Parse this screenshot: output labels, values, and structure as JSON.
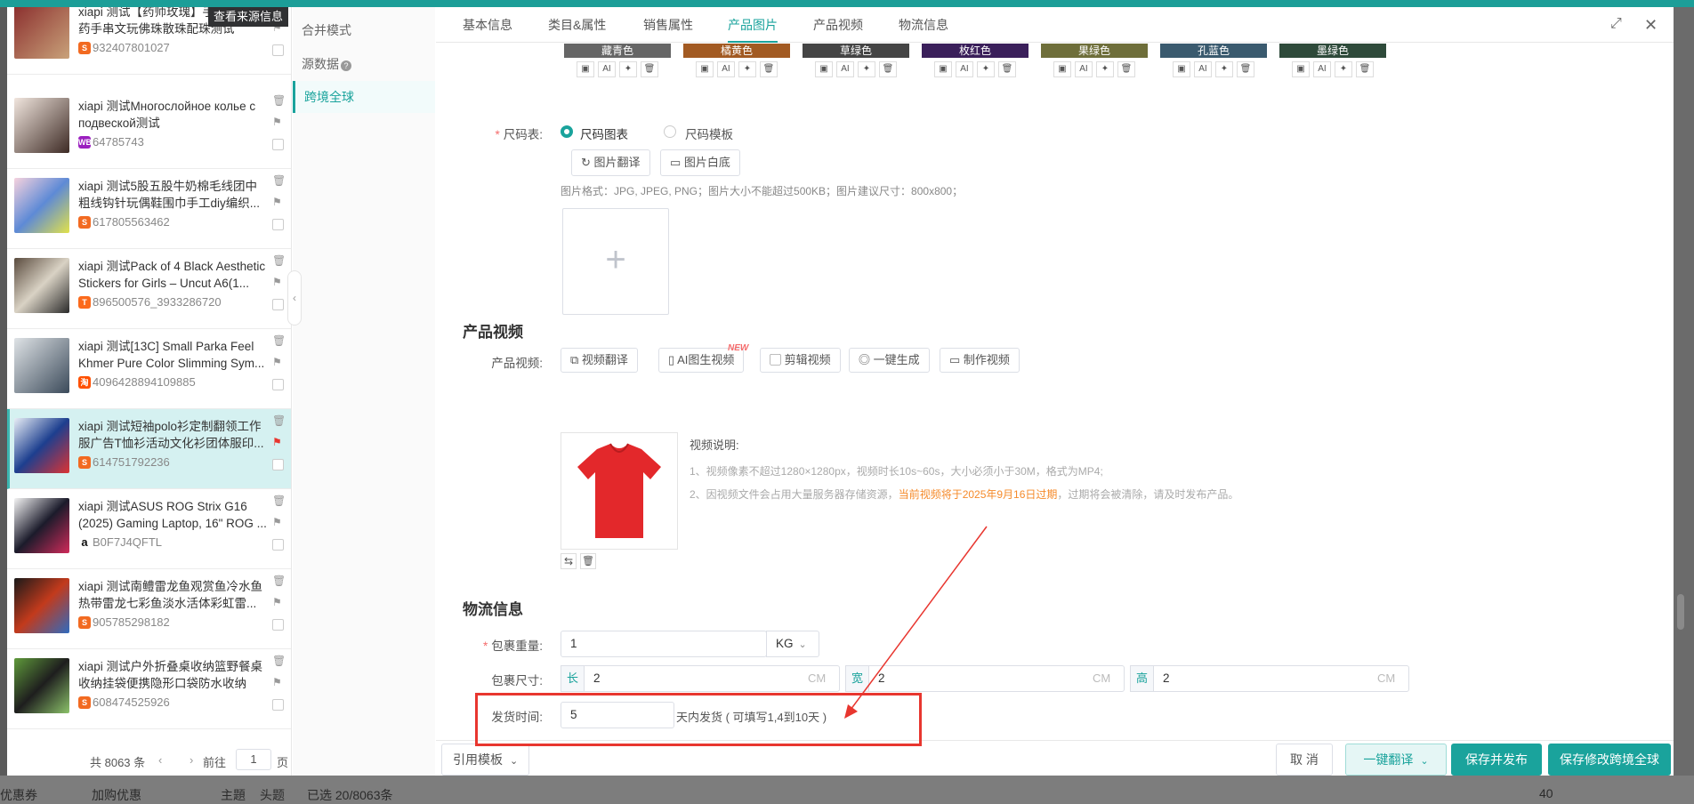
{
  "colors": {
    "accent": "#1aa39c",
    "danger": "#e8362f",
    "warning": "#f58a2a"
  },
  "list": {
    "tooltip": "查看来源信息",
    "items": [
      {
        "title": "xiapi 测试【药师玫瑰】手串厂家中药手串文玩佛珠散珠配珠测试",
        "id": "932407801027",
        "badge": "shopee",
        "badge_color": "#f26a21"
      },
      {
        "title": "xiapi 测试Многослойное колье с подвеской测试",
        "id": "64785743",
        "badge": "WB",
        "badge_color": "#9b1fbf"
      },
      {
        "title": "xiapi 测试5股五股牛奶棉毛线团中粗线钩针玩偶鞋围巾手工diy编织...",
        "id": "617805563462",
        "badge": "shopee",
        "badge_color": "#f26a21"
      },
      {
        "title": "xiapi 测试Pack of 4 Black Aesthetic Stickers for Girls – Uncut A6(1...",
        "id": "896500576_3933286720",
        "badge": "temu",
        "badge_color": "#fb6a1c"
      },
      {
        "title": "xiapi 测试[13C] Small Parka Feel Khmer Pure Color Slimming Sym...",
        "id": "4096428894109885",
        "badge": "taobao",
        "badge_color": "#ff5000"
      },
      {
        "title": "xiapi 测试短袖polo衫定制翻领工作服广告T恤衫活动文化衫团体服印...",
        "id": "614751792236",
        "badge": "shopee",
        "badge_color": "#f26a21"
      },
      {
        "title": "xiapi 测试ASUS ROG Strix G16 (2025) Gaming Laptop, 16\" ROG ...",
        "id": "B0F7J4QFTL",
        "badge": "amazon",
        "badge_color": "#ffffff"
      },
      {
        "title": "xiapi 测试南鳢雷龙鱼观赏鱼冷水鱼热带雷龙七彩鱼淡水活体彩虹雷...",
        "id": "905785298182",
        "badge": "shopee",
        "badge_color": "#f26a21"
      },
      {
        "title": "xiapi 测试户外折叠桌收纳篮野餐桌收纳挂袋便携隐形口袋防水收纳袋...",
        "id": "608474525926",
        "badge": "shopee",
        "badge_color": "#f26a21"
      }
    ],
    "footer": {
      "total": "共 8063 条",
      "goto": "前往",
      "page": "1",
      "page_unit": "页"
    }
  },
  "mid_nav": [
    "合并模式",
    "源数据",
    "跨境全球"
  ],
  "tabs": [
    "基本信息",
    "类目&属性",
    "销售属性",
    "产品图片",
    "产品视频",
    "物流信息"
  ],
  "active_tab": 3,
  "sku_colors": [
    "藏青色",
    "橘黄色",
    "草绿色",
    "枚红色",
    "果绿色",
    "孔蓝色",
    "墨绿色"
  ],
  "size_chart": {
    "label": "尺码表:",
    "option1": "尺码图表",
    "option2": "尺码模板",
    "btn_translate": "图片翻译",
    "btn_white": "图片白底",
    "hint": "图片格式：JPG, JPEG, PNG；图片大小不能超过500KB；图片建议尺寸：800x800；"
  },
  "video": {
    "section": "产品视频",
    "label": "产品视频:",
    "buttons": [
      "视频翻译",
      "AI图生视频",
      "剪辑视频",
      "一键生成",
      "制作视频"
    ],
    "new_badge": "NEW",
    "note_title": "视频说明:",
    "note1": "1、视频像素不超过1280×1280px，视频时长10s~60s，大小必须小于30M，格式为MP4;",
    "note2a": "2、因视频文件会占用大量服务器存储资源，",
    "note2b": "当前视频将于2025年9月16日过期",
    "note2c": "，过期将会被清除，请及时发布产品。"
  },
  "logistics": {
    "section": "物流信息",
    "weight_label": "包裹重量:",
    "weight_value": "1",
    "weight_unit": "KG",
    "size_label": "包裹尺寸:",
    "len_label": "长",
    "len_value": "2",
    "wid_label": "宽",
    "wid_value": "2",
    "hei_label": "高",
    "hei_value": "2",
    "cm": "CM",
    "ship_label": "发货时间:",
    "ship_value": "5",
    "ship_hint": "天内发货 ( 可填写1,4到10天 )"
  },
  "footer": {
    "template": "引用模板",
    "cancel": "取 消",
    "translate": "一键翻译",
    "save_publish": "保存并发布",
    "save_cross": "保存修改跨境全球"
  },
  "background": {
    "left1": "优惠券",
    "left2": "加购优惠",
    "mid": "主題",
    "mid2": "头题",
    "page": "已选 20/8063条",
    "right": "40"
  }
}
